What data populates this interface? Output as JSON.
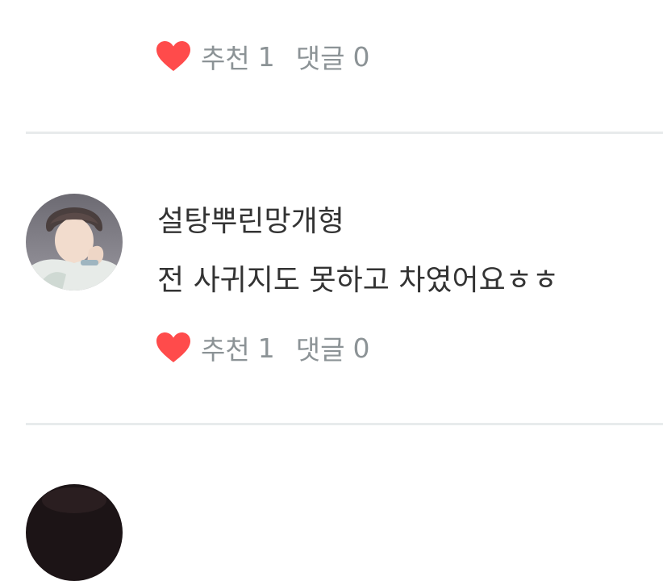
{
  "comments": [
    {
      "author": "",
      "text": "",
      "likes_label": "추천",
      "likes_count": "1",
      "replies_label": "댓글",
      "replies_count": "0"
    },
    {
      "author": "설탕뿌린망개형",
      "text": "전 사귀지도 못하고 차였어요ㅎㅎ",
      "likes_label": "추천",
      "likes_count": "1",
      "replies_label": "댓글",
      "replies_count": "0"
    },
    {
      "author": "",
      "text": "",
      "likes_label": "",
      "likes_count": "",
      "replies_label": "",
      "replies_count": ""
    }
  ],
  "colors": {
    "heart": "#ff4b4b",
    "meta_text": "#8c9396",
    "body_text": "#333333",
    "divider": "#e8ebec"
  },
  "icons": {
    "like": "heart-icon"
  }
}
